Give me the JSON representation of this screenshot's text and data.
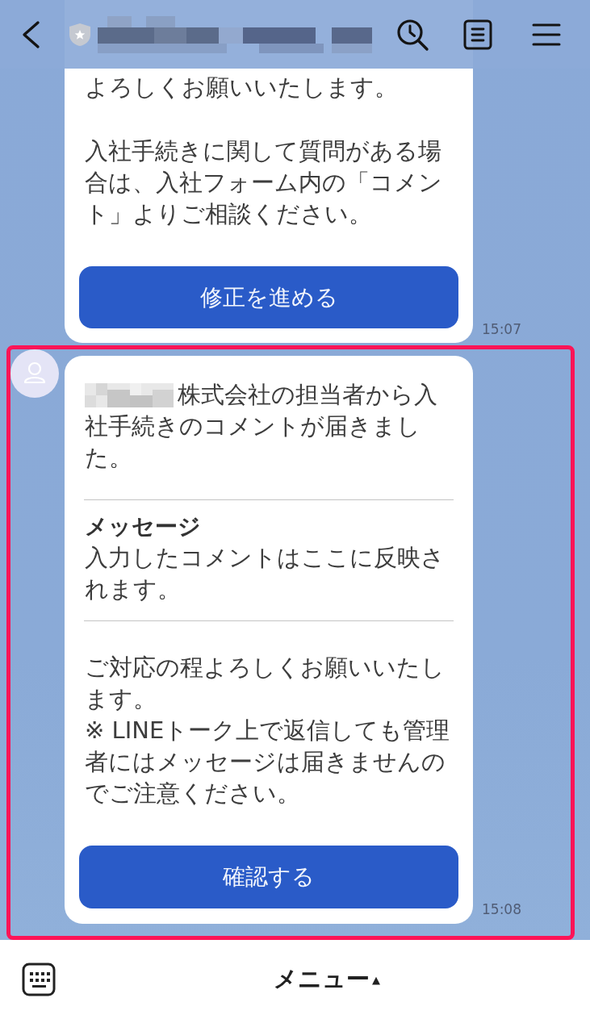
{
  "header": {
    "title_redacted": true
  },
  "messages": [
    {
      "show_avatar": false,
      "highlighted": false,
      "blocks": [
        {
          "kind": "text",
          "redacted_prefix": false,
          "lines": [
            "よろしくお願いいたします。"
          ]
        },
        {
          "kind": "text",
          "redacted_prefix": false,
          "lines": [
            "入社手続きに関して質問がある場",
            "合は、入社フォーム内の「コメン",
            "ト」よりご相談ください。"
          ]
        },
        {
          "kind": "button",
          "label": "修正を進める"
        }
      ],
      "time": "15:07"
    },
    {
      "show_avatar": true,
      "highlighted": true,
      "blocks": [
        {
          "kind": "text",
          "redacted_prefix": true,
          "lines": [
            "株式会社の担当者から入",
            "社手続きのコメントが届きまし",
            "た。"
          ]
        },
        {
          "kind": "separator"
        },
        {
          "kind": "heading",
          "text": "メッセージ"
        },
        {
          "kind": "text",
          "redacted_prefix": false,
          "lines": [
            "入力したコメントはここに反映さ",
            "れます。"
          ]
        },
        {
          "kind": "separator"
        },
        {
          "kind": "text",
          "redacted_prefix": false,
          "lines": [
            "ご対応の程よろしくお願いいたし",
            "ます。",
            "※ LINEトーク上で返信しても管理",
            "者にはメッセージは届きませんの",
            "でご注意ください。"
          ]
        },
        {
          "kind": "button",
          "label": "確認する"
        }
      ],
      "time": "15:08"
    }
  ],
  "bottom_bar": {
    "menu_label": "メニュー",
    "menu_arrow": "▲"
  }
}
